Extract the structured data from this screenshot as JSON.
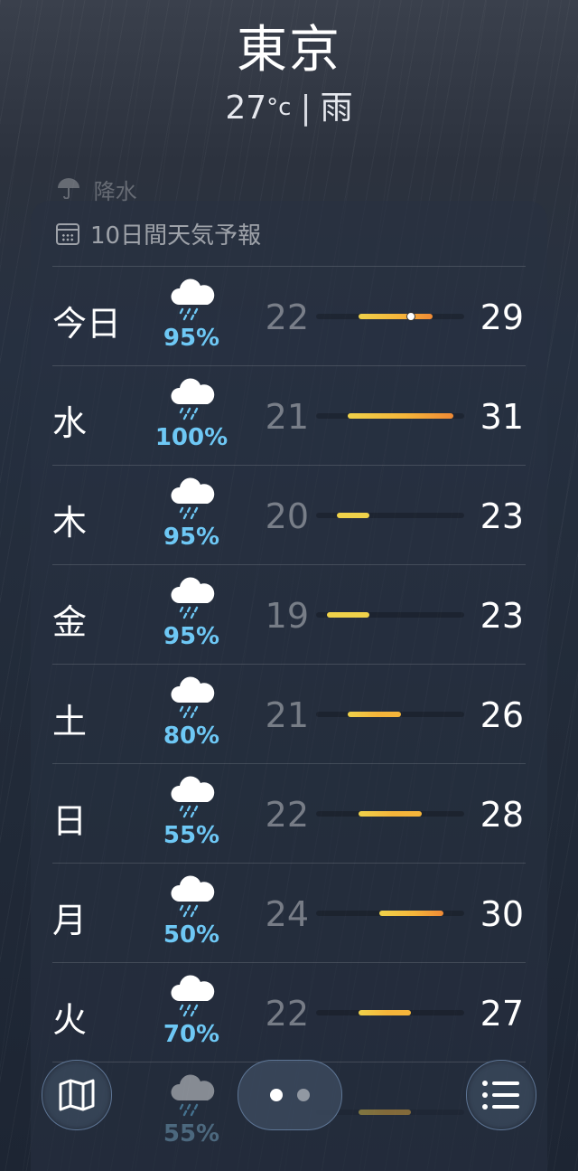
{
  "header": {
    "city": "東京",
    "temperature": "27",
    "temp_unit": "°c",
    "separator": "|",
    "condition": "雨"
  },
  "precip_hint": {
    "icon": "umbrella-icon",
    "label": "降水"
  },
  "forecast": {
    "icon": "calendar-icon",
    "title": "10日間天気予報",
    "bar_range": {
      "min": 18,
      "max": 32
    },
    "colors": {
      "cool": "#f0d24a",
      "mid": "#f5b53a",
      "warm": "#ef8a35",
      "precip_text": "#6ec8f5"
    },
    "days": [
      {
        "day": "今日",
        "icon": "rain-cloud-icon",
        "precip": "95%",
        "low": "22",
        "high": "29",
        "current": 27
      },
      {
        "day": "水",
        "icon": "rain-cloud-icon",
        "precip": "100%",
        "low": "21",
        "high": "31"
      },
      {
        "day": "木",
        "icon": "rain-cloud-icon",
        "precip": "95%",
        "low": "20",
        "high": "23"
      },
      {
        "day": "金",
        "icon": "rain-cloud-icon",
        "precip": "95%",
        "low": "19",
        "high": "23"
      },
      {
        "day": "土",
        "icon": "rain-cloud-icon",
        "precip": "80%",
        "low": "21",
        "high": "26"
      },
      {
        "day": "日",
        "icon": "rain-cloud-icon",
        "precip": "55%",
        "low": "22",
        "high": "28"
      },
      {
        "day": "月",
        "icon": "rain-cloud-icon",
        "precip": "50%",
        "low": "24",
        "high": "30"
      },
      {
        "day": "火",
        "icon": "rain-cloud-icon",
        "precip": "70%",
        "low": "22",
        "high": "27"
      },
      {
        "day": "",
        "icon": "rain-cloud-icon",
        "precip": "55%",
        "low": "",
        "high": "",
        "bar_low": 22,
        "bar_high": 27
      }
    ]
  },
  "toolbar": {
    "map_icon": "map-icon",
    "list_icon": "list-icon",
    "page_count": 2,
    "active_page": 1
  }
}
